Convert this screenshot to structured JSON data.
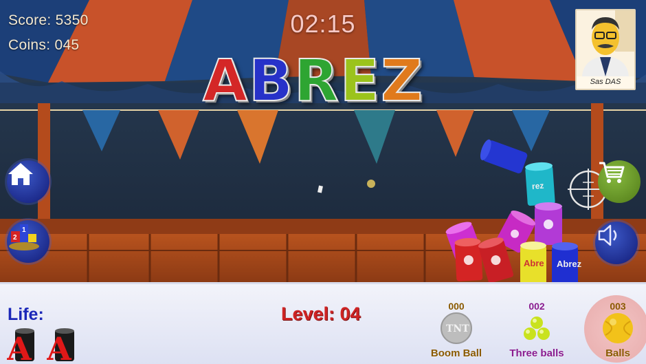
{
  "hud": {
    "score": "Score: 5350",
    "coins": "Coins: 045",
    "timer": "02:15"
  },
  "logo": {
    "letters": [
      {
        "char": "A",
        "color": "#d42727"
      },
      {
        "char": "B",
        "color": "#2732c9"
      },
      {
        "char": "R",
        "color": "#2ea532"
      },
      {
        "char": "E",
        "color": "#9bc31c"
      },
      {
        "char": "Z",
        "color": "#e07a1c"
      }
    ]
  },
  "player": {
    "name": "Sas DAS"
  },
  "controls": {
    "home_icon": "home-icon",
    "leaderboard_icon": "podium-icon",
    "shop_icon": "shopping-cart-icon",
    "aim_icon": "crosshair-icon",
    "sound_icon": "speaker-icon"
  },
  "cans": {
    "label": "Abrez",
    "colors": [
      "#1f2fd1",
      "#1fb7c9",
      "#b23ad6",
      "#c72ac4",
      "#d42424",
      "#e8e02a"
    ]
  },
  "status": {
    "life_label": "Life:",
    "lives_remaining": 2,
    "level": "Level: 04"
  },
  "powerups": [
    {
      "count": "000",
      "name": "Boom Ball",
      "icon": "tnt-ball-icon",
      "count_color": "#8a5a00",
      "name_color": "#8a5a00",
      "selected": false
    },
    {
      "count": "002",
      "name": "Three balls",
      "icon": "three-balls-icon",
      "count_color": "#8a1c8f",
      "name_color": "#8a1c8f",
      "selected": false
    },
    {
      "count": "003",
      "name": "Balls",
      "icon": "ball-icon",
      "count_color": "#8a5a00",
      "name_color": "#8a5a00",
      "selected": true
    }
  ]
}
